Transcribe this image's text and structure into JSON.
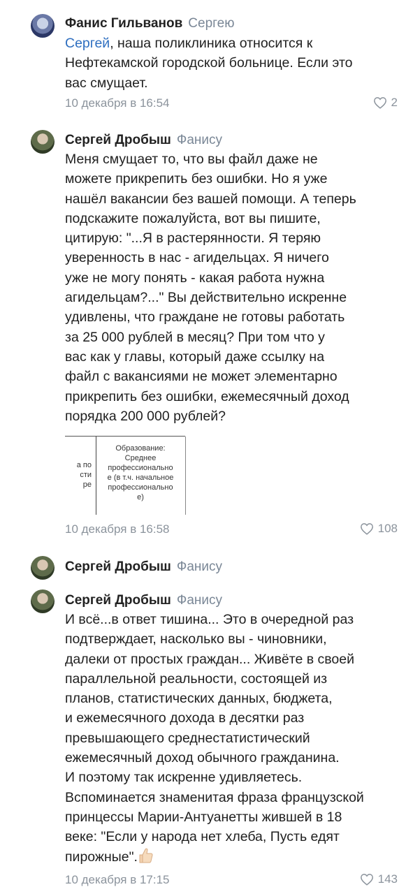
{
  "comments": [
    {
      "author": "Фанис Гильванов",
      "reply_to": "Сергею",
      "mention": "Сергей",
      "lines": [
        ", наша поликлиника относится к",
        "Нефтекамской городской больнице. Если это",
        "вас смущает."
      ],
      "date": "10 декабря в 16:54",
      "likes": "2"
    },
    {
      "author": "Сергей Дробыш",
      "reply_to": "Фанису",
      "lines": [
        "Меня смущает то, что вы файл даже не",
        "можете прикрепить без ошибки. Но я уже",
        "нашёл вакансии без вашей помощи. А теперь",
        "подскажите пожалуйста, вот вы пишите,",
        "цитирую: \"...Я в растерянности. Я теряю",
        "уверенность в нас - агидельцах. Я ничего",
        "уже не могу понять - какая работа нужна",
        "агидельцам?...\" Вы действительно искренне",
        "удивлены, что граждане не готовы работать",
        "за 25 000 рублей в месяц? При том что у",
        "вас как у главы, который даже ссылку на",
        "файл с вакансиями не может элементарно",
        "прикрепить без ошибки, ежемесячный доход",
        "порядка 200 000 рублей?"
      ],
      "attachment": {
        "left_cell": [
          "а по",
          "сти",
          "ре"
        ],
        "right_cell": [
          "Образование:",
          "Среднее",
          "профессионально",
          "е (в т.ч. начальное",
          "профессионально",
          "е)"
        ]
      },
      "date": "10 декабря в 16:58",
      "likes": "108"
    },
    {
      "author": "Сергей Дробыш",
      "reply_to": "Фанису"
    },
    {
      "author": "Сергей Дробыш",
      "reply_to": "Фанису",
      "lines": [
        "И всё...в ответ тишина... Это в очередной раз",
        "подтверждает, насколько вы - чиновники,",
        "далеки от простых граждан... Живёте в своей",
        "параллельной реальности, состоящей из",
        "планов, статистических данных, бюджета,",
        "и ежемесячного дохода в десятки раз",
        "превышающего среднестатистический",
        "ежемесячный доход обычного гражданина.",
        "И поэтому так искренне удивляетесь.",
        "Вспоминается знаменитая фраза французской",
        "принцессы Марии-Антуанетты жившей в 18",
        "веке: \"Если у народа нет хлеба, Пусть едят",
        "пирожные\"."
      ],
      "emoji": "thumbs-up",
      "date": "10 декабря в 17:15",
      "likes": "143"
    }
  ]
}
